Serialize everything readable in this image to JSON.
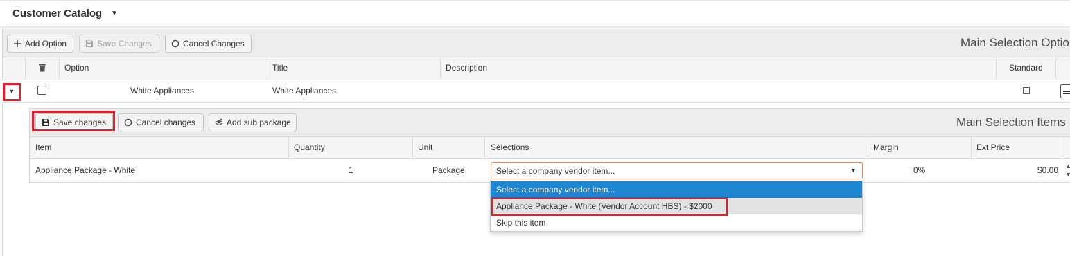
{
  "header": {
    "title": "Customer Catalog",
    "caret": "▼"
  },
  "toolbar": {
    "add_option": "Add Option",
    "save_changes": "Save Changes",
    "cancel_changes": "Cancel Changes",
    "section_title": "Main Selection Optio"
  },
  "grid": {
    "columns": {
      "option": "Option",
      "title": "Title",
      "description": "Description",
      "standard": "Standard"
    },
    "rows": [
      {
        "option": "White Appliances",
        "title": "White Appliances",
        "description": "",
        "standard_checked": false
      }
    ]
  },
  "detail": {
    "toolbar": {
      "save_changes": "Save changes",
      "cancel_changes": "Cancel changes",
      "add_sub_package": "Add sub package",
      "section_title": "Main Selection Items"
    },
    "columns": {
      "item": "Item",
      "quantity": "Quantity",
      "unit": "Unit",
      "selections": "Selections",
      "margin": "Margin",
      "ext_price": "Ext Price"
    },
    "rows": [
      {
        "item": "Appliance Package - White",
        "quantity": "1",
        "unit": "Package",
        "selection": "Select a company vendor item...",
        "margin": "0%",
        "ext_price": "$0.00"
      }
    ],
    "dropdown_options": [
      "Select a company vendor item...",
      "Appliance Package - White (Vendor Account HBS) - $2000",
      "Skip this item"
    ]
  },
  "colors": {
    "highlight_red": "#e0202a",
    "selected_blue": "#1e87d0",
    "hover_gray": "#e3e3e3"
  }
}
